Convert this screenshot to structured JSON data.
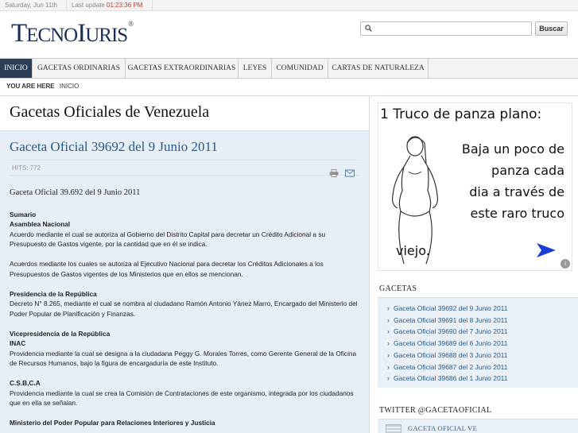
{
  "topbar": {
    "date": "Saturday, Jun 11th",
    "last_update_label": "Last update",
    "last_update_time": "01:23:36 PM"
  },
  "header": {
    "logo_first": "T",
    "logo_rest1": "ECNO",
    "logo_second": "I",
    "logo_rest2": "URIS",
    "logo_reg": "®",
    "search_placeholder": "",
    "search_button": "Buscar"
  },
  "nav": {
    "items": [
      {
        "label": "INICIO"
      },
      {
        "label": "GACETAS ORDINARIAS"
      },
      {
        "label": "GACETAS EXTRAORDINARIAS"
      },
      {
        "label": "LEYES"
      },
      {
        "label": "COMUNIDAD"
      },
      {
        "label": "CARTAS DE NATURALEZA"
      }
    ]
  },
  "breadcrumb": {
    "label": "YOU ARE HERE",
    "current": "INICIO"
  },
  "main": {
    "page_title": "Gacetas Oficiales de Venezuela",
    "article_title": "Gaceta Oficial 39692 del 9 Junio 2011",
    "hits": "HITS: 772",
    "content_heading": "Gaceta Oficial 39.692 del 9 Junio 2011",
    "sumario": "Sumario",
    "s1_title": "Asamblea Nacional",
    "s1_p1": "Acuerdo mediante el cual se autoriza al Gobierno del Distrito Capital para decretar un Crédito Adicional a su Presupuesto de Gastos vigente, por la cantidad que en él se indica.",
    "s1_p2": "Acuerdos mediante los cuales se autoriza al Ejecutivo Nacional para decretar los Créditos Adicionales a los Presupuestos de Gastos vigentes de los Ministerios que en ellos se mencionan.",
    "s2_title": "Presidencia de la República",
    "s2_p1": "Decreto N° 8.265, mediante el cual se nombra al ciudadano Ramón Antonio Yánez Marro, Encargado del Ministerio del Poder Popular de Planificación y Finanzas.",
    "s3_title": "Vicepresidencia de la República",
    "s3_sub": "INAC",
    "s3_p1": "Providencia mediante la cual se designa a la ciudadana Peggy G. Morales Torres, como Gerente General de la Oficina de Recursos Humanos, bajo la figura de encargaduría de este Instituto.",
    "s4_title": "C.S.B,C.A",
    "s4_p1": "Providencia mediante la cual se crea la Comisión de Contrataciones de este organismo, integrada por los ciudadanos que en ella se señalan.",
    "s5_title": "Ministerio del Poder Popular para Relaciones Interiores y Justicia"
  },
  "ad": {
    "title": "1 Truco de panza plano:",
    "line1": "Baja un poco de",
    "line2": "panza cada",
    "line3": "dia a través de",
    "line4": "este raro truco",
    "line5": "viejo.",
    "accent": "#1a3fd6"
  },
  "sidebar": {
    "gacetas_title": "GACETAS",
    "gacetas": [
      "Gaceta Oficial 39692 del 9 Junio 2011",
      "Gaceta Oficial 39691 del 8 Junio 2011",
      "Gaceta Oficial 39690 del 7 Junio 2011",
      "Gaceta Oficial 39689 del 6 Junio 2011",
      "Gaceta Oficial 39688 del 3 Junio 2011",
      "Gaceta Oficial 39687 del 2 Junio 2011",
      "Gaceta Oficial 39686 del 1 Junio 2011"
    ],
    "twitter_title": "TWITTER @GACETAOFICIAL",
    "twitter_name": "GACETA OFICIAL VE"
  }
}
